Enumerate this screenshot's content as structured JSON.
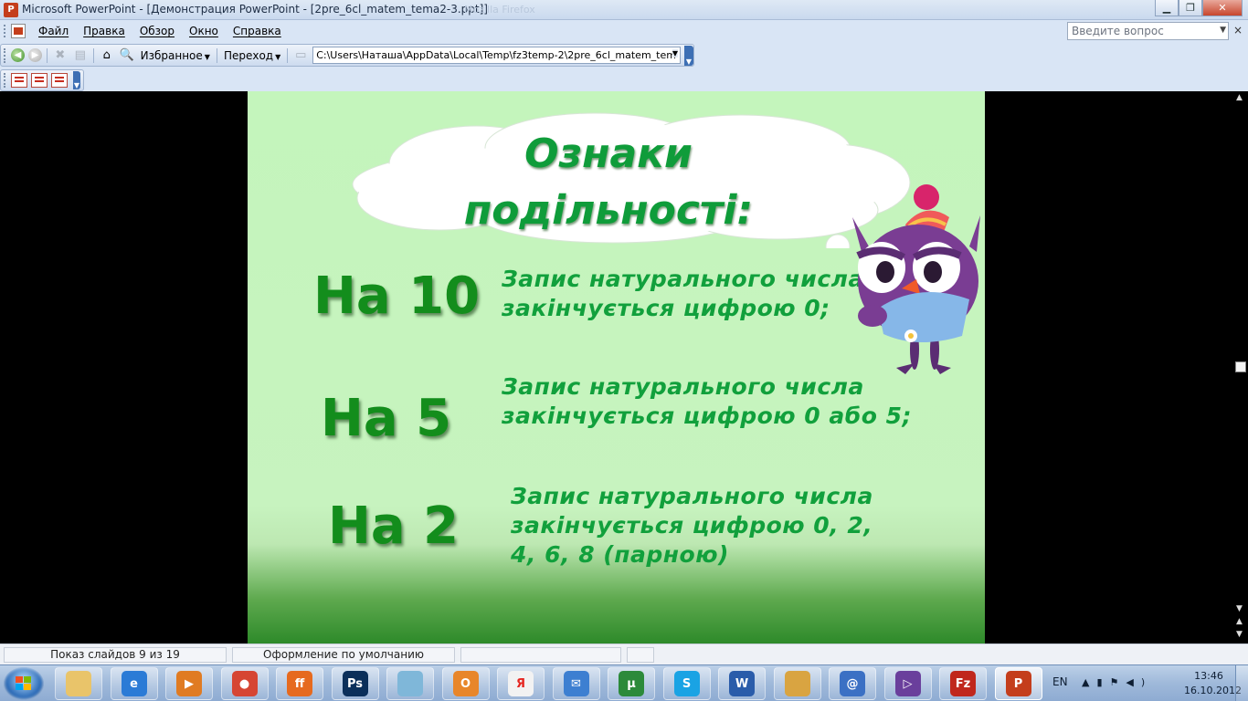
{
  "window": {
    "title": "Microsoft PowerPoint - [Демонстрация PowerPoint - [2pre_6cl_matem_tema2-3.ppt]]",
    "ghost_title": "Mozilla Firefox",
    "controls": {
      "minimize": "▁",
      "maximize": "❐",
      "close": "✕"
    }
  },
  "menu": {
    "items": [
      {
        "label": "Файл"
      },
      {
        "label": "Правка"
      },
      {
        "label": "Обзор"
      },
      {
        "label": "Окно"
      },
      {
        "label": "Справка"
      }
    ],
    "help_placeholder": "Введите вопрос",
    "help_close": "×"
  },
  "web_toolbar": {
    "favorites_label": "Избранное",
    "go_label": "Переход",
    "address_value": "C:\\Users\\Наташа\\AppData\\Local\\Temp\\fz3temp-2\\2pre_6cl_matem_tem"
  },
  "slide": {
    "title_line1": "Ознаки",
    "title_line2": "подільності:",
    "rules": [
      {
        "label": "На 10",
        "lines": [
          "Запис натурального числа",
          "закінчується цифрою 0;"
        ]
      },
      {
        "label": "На 5",
        "lines": [
          "Запис натурального числа",
          "закінчується цифрою 0 або 5;"
        ]
      },
      {
        "label": "На 2",
        "lines": [
          "Запис натурального числа",
          "закінчується цифрою 0, 2,",
          "4, 6, 8 (парною)"
        ]
      }
    ]
  },
  "status": {
    "slide_info": "Показ слайдов 9 из 19",
    "design": "Оформление по умолчанию"
  },
  "taskbar": {
    "apps": [
      {
        "name": "explorer",
        "label": "",
        "color": "#e9c46a"
      },
      {
        "name": "internet-explorer",
        "label": "e",
        "color": "#2b7bd6"
      },
      {
        "name": "media-player",
        "label": "▶",
        "color": "#e07b22"
      },
      {
        "name": "chrome",
        "label": "●",
        "color": "#d64533"
      },
      {
        "name": "firefox",
        "label": "ff",
        "color": "#e66a1f"
      },
      {
        "name": "photoshop",
        "label": "Ps",
        "color": "#0b2f5a"
      },
      {
        "name": "notes",
        "label": "",
        "color": "#7fb7d9"
      },
      {
        "name": "outlook",
        "label": "O",
        "color": "#e8862a"
      },
      {
        "name": "yandex",
        "label": "Я",
        "color": "#f2f2f2"
      },
      {
        "name": "mail",
        "label": "✉",
        "color": "#3d7fd1"
      },
      {
        "name": "utorrent",
        "label": "µ",
        "color": "#2c8a3a"
      },
      {
        "name": "skype",
        "label": "S",
        "color": "#1aa3e4"
      },
      {
        "name": "word",
        "label": "W",
        "color": "#2a5caa"
      },
      {
        "name": "paint",
        "label": "",
        "color": "#d9a441"
      },
      {
        "name": "email-client",
        "label": "@",
        "color": "#3b70c4"
      },
      {
        "name": "visual-studio",
        "label": "▷",
        "color": "#6a3f9c"
      },
      {
        "name": "filezilla",
        "label": "Fz",
        "color": "#c0271c"
      },
      {
        "name": "powerpoint",
        "label": "P",
        "color": "#c43e1c"
      }
    ],
    "lang": "EN",
    "time": "13:46",
    "date": "16.10.2012"
  }
}
